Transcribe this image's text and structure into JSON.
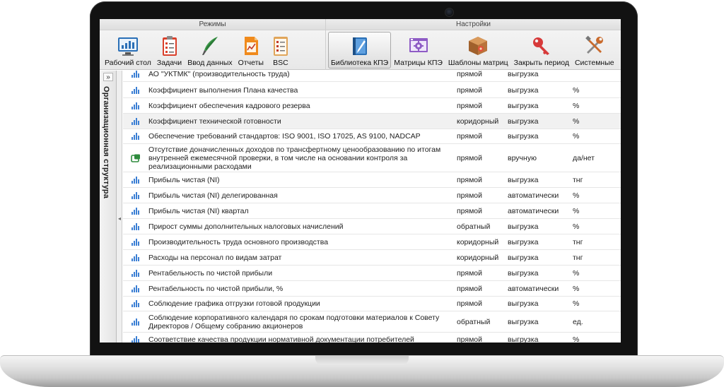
{
  "ribbon": {
    "modes_title": "Режимы",
    "settings_title": "Настройки",
    "modes": [
      {
        "label": "Рабочий стол",
        "icon": "dashboard-chart-icon"
      },
      {
        "label": "Задачи",
        "icon": "task-clipboard-icon"
      },
      {
        "label": "Ввод данных",
        "icon": "quill-pen-icon"
      },
      {
        "label": "Отчеты",
        "icon": "report-document-icon"
      },
      {
        "label": "BSC",
        "icon": "bsc-checklist-icon"
      }
    ],
    "settings": [
      {
        "label": "Библиотека КПЭ",
        "icon": "kpi-library-book-icon",
        "active": true
      },
      {
        "label": "Матрицы КПЭ",
        "icon": "kpi-matrix-gear-icon"
      },
      {
        "label": "Шаблоны матриц",
        "icon": "matrix-template-box-icon"
      },
      {
        "label": "Закрыть период",
        "icon": "key-icon"
      },
      {
        "label": "Системные",
        "icon": "tools-wrench-icon"
      }
    ]
  },
  "side_panel": {
    "toggle": "»",
    "title": "Организационная структура",
    "grip": "◂"
  },
  "kpi_table": {
    "rows": [
      {
        "icon": "bar",
        "name": "АО \"УКТМК\" (производительность труда)",
        "type": "прямой",
        "load": "выгрузка",
        "unit": ""
      },
      {
        "icon": "bar",
        "name": "Коэффициент выполнения Плана качества",
        "type": "прямой",
        "load": "выгрузка",
        "unit": "%"
      },
      {
        "icon": "bar",
        "name": "Коэффициент обеспечения кадрового резерва",
        "type": "прямой",
        "load": "выгрузка",
        "unit": "%"
      },
      {
        "icon": "bar",
        "name": "Коэффициент технической готовности",
        "type": "коридорный",
        "load": "выгрузка",
        "unit": "%"
      },
      {
        "icon": "bar",
        "name": "Обеспечение требований стандартов: ISO 9001, ISO 17025, AS 9100, NADCAP",
        "type": "прямой",
        "load": "выгрузка",
        "unit": "%"
      },
      {
        "icon": "doc",
        "name": "Отсутствие доначисленных доходов по трансфертному ценообразованию по итогам внутренней ежемесячной проверки, в том числе на основании контроля за реализационными расходами",
        "type": "прямой",
        "load": "вручную",
        "unit": "да/нет"
      },
      {
        "icon": "bar",
        "name": "Прибыль чистая (NI)",
        "type": "прямой",
        "load": "выгрузка",
        "unit": "тнг"
      },
      {
        "icon": "bar",
        "name": "Прибыль чистая (NI) делегированная",
        "type": "прямой",
        "load": "автоматически",
        "unit": "%"
      },
      {
        "icon": "bar",
        "name": "Прибыль чистая (NI) квартал",
        "type": "прямой",
        "load": "автоматически",
        "unit": "%"
      },
      {
        "icon": "bar",
        "name": "Прирост суммы дополнительных налоговых начислений",
        "type": "обратный",
        "load": "выгрузка",
        "unit": "%"
      },
      {
        "icon": "bar",
        "name": "Производительность труда основного производства",
        "type": "коридорный",
        "load": "выгрузка",
        "unit": "тнг"
      },
      {
        "icon": "bar",
        "name": "Расходы на персонал по видам затрат",
        "type": "коридорный",
        "load": "выгрузка",
        "unit": "тнг"
      },
      {
        "icon": "bar",
        "name": "Рентабельность по чистой прибыли",
        "type": "прямой",
        "load": "выгрузка",
        "unit": "%"
      },
      {
        "icon": "bar",
        "name": "Рентабельность по чистой прибыли, %",
        "type": "прямой",
        "load": "автоматически",
        "unit": "%"
      },
      {
        "icon": "bar",
        "name": "Соблюдение графика отгрузки готовой продукции",
        "type": "прямой",
        "load": "выгрузка",
        "unit": "%"
      },
      {
        "icon": "bar",
        "name": "Соблюдение корпоративного календаря по срокам подготовки материалов к Совету Директоров / Общему собранию акционеров",
        "type": "обратный",
        "load": "выгрузка",
        "unit": "ед."
      },
      {
        "icon": "bar",
        "name": "Соответствие качества продукции нормативной документации потребителей",
        "type": "прямой",
        "load": "выгрузка",
        "unit": "%"
      }
    ]
  },
  "colors": {
    "bar_icon": "#3b7fd4",
    "doc_icon": "#2e8b3d",
    "active_button_border": "#a9a9a9"
  }
}
